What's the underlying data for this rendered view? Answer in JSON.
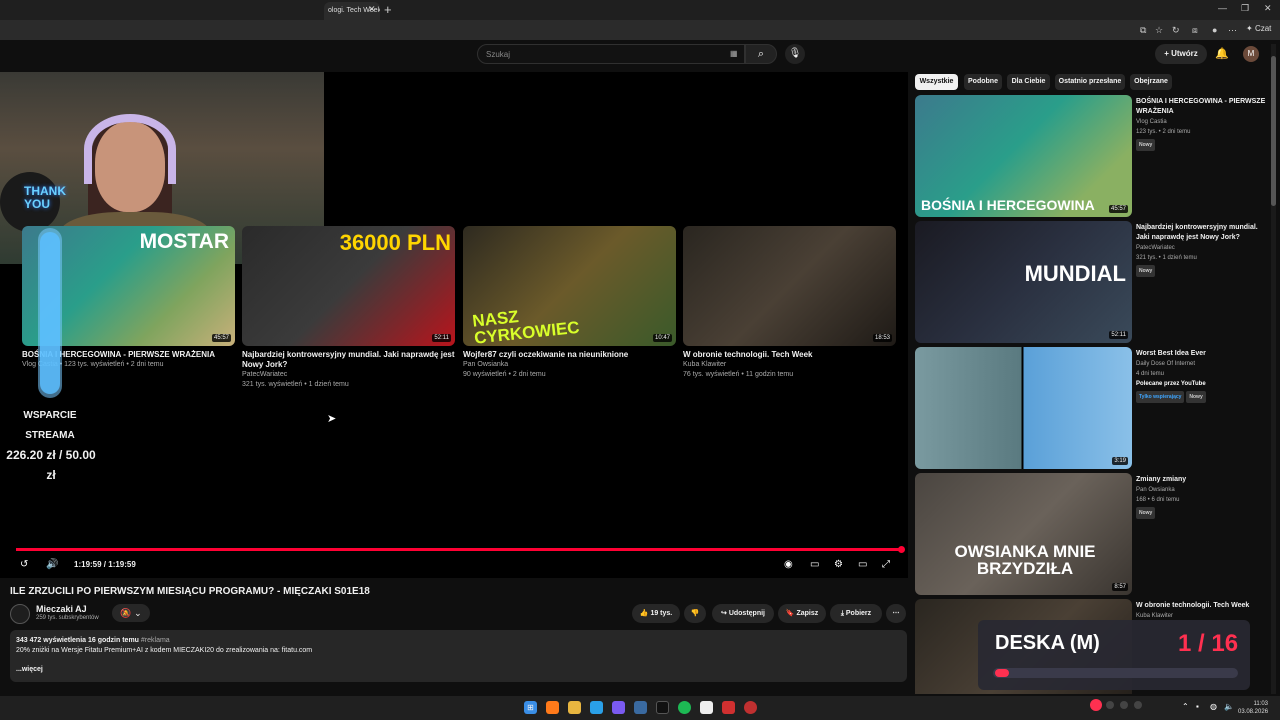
{
  "browser": {
    "tab_title": "ologi. Tech Week",
    "copilot_label": "Czat"
  },
  "header": {
    "search_placeholder": "Szukaj",
    "create_label": "Utwórz",
    "avatar_letter": "M"
  },
  "overlay": {
    "thankyou": "THANK YOU",
    "support_label": "WSPARCIE STREAMA",
    "support_amount": "226.20 zł / 50.00 zł",
    "deska_label": "DESKA (M)",
    "deska_count": "1 / 16",
    "deska_progress": 0.06
  },
  "endcards": [
    {
      "title": "BOŚNIA I HERCEGOWINA - PIERWSZE WRAŻENIA",
      "meta": "Vlog Castia • 123 tys. wyświetleń • 2 dni temu",
      "duration": "45:57",
      "thumb_text": "MOSTAR"
    },
    {
      "title": "Najbardziej kontrowersyjny mundial. Jaki naprawdę jest Nowy Jork?",
      "channel": "PatecWariatec",
      "meta": "321 tys. wyświetleń • 1 dzień temu",
      "duration": "52:11",
      "thumb_text": "36000 PLN"
    },
    {
      "title": "Wojfer87 czyli oczekiwanie na nieuniknione",
      "channel": "Pan Owsianka",
      "meta": "90 wyświetleń • 2 dni temu",
      "duration": "10:47",
      "thumb_text": "NASZ CYRKOWIEC"
    },
    {
      "title": "W obronie technologii. Tech Week",
      "channel": "Kuba Klawiter",
      "meta": "76 tys. wyświetleń • 11 godzin temu",
      "duration": "18:53",
      "thumb_text": ""
    }
  ],
  "player": {
    "time": "1:19:59 / 1:19:59",
    "progress": 1.0
  },
  "video": {
    "title": "ILE ZRZUCILI PO PIERWSZYM MIESIĄCU PROGRAMU? - MIĘCZAKI S01E18",
    "channel_name": "Mieczaki AJ",
    "channel_subs": "259 tys. subskrybentów",
    "likes": "19 tys.",
    "share_label": "Udostępnij",
    "save_label": "Zapisz",
    "download_label": "Pobierz",
    "desc_stats": "343 472 wyświetlenia  16 godzin temu",
    "desc_tag": "#reklama",
    "desc_text": "20% zniżki na Wersje Fitatu Premium+AI z kodem MIECZAKI20 do zrealizowania na: fitatu.com",
    "desc_more": "...więcej"
  },
  "chips": [
    "Wszystkie",
    "Podobne",
    "Dla Ciebie",
    "Ostatnio przesłane",
    "Obejrzane"
  ],
  "sidebar": [
    {
      "title": "BOŚNIA I HERCEGOWINA - PIERWSZE WRAŻENIA",
      "channel": "Vlog Castia",
      "meta": "123 tys. • 2 dni temu",
      "badge": "Nowy",
      "duration": "45:57",
      "thumb_text": "BOŚNIA I HERCEGOWINA"
    },
    {
      "title": "Najbardziej kontrowersyjny mundial. Jaki naprawdę jest Nowy Jork?",
      "channel": "PatecWariatec",
      "meta": "321 tys. • 1 dzień temu",
      "badge": "Nowy",
      "duration": "52:11",
      "thumb_text": "MUNDIAL"
    },
    {
      "title": "Worst Best Idea Ever",
      "channel": "Daily Dose Of Internet",
      "meta": "4 dni temu",
      "extra": "Polecane przez YouTube",
      "badge_green": "Tylko wspierający",
      "badge": "Nowy",
      "duration": "3:19",
      "thumb_text": ""
    },
    {
      "title": "Zmiany zmiany",
      "channel": "Pan Owsianka",
      "meta": "168 • 6 dni temu",
      "badge": "Nowy",
      "duration": "8:57",
      "thumb_text": "OWSIANKA MNIE BRZYDZIŁA"
    },
    {
      "title": "W obronie technologii. Tech Week",
      "channel": "Kuba Klawiter",
      "meta": "",
      "badge": "Nowy",
      "duration": "",
      "thumb_text": ""
    }
  ],
  "taskbar": {
    "time": "11:03",
    "date": "03.08.2026"
  }
}
